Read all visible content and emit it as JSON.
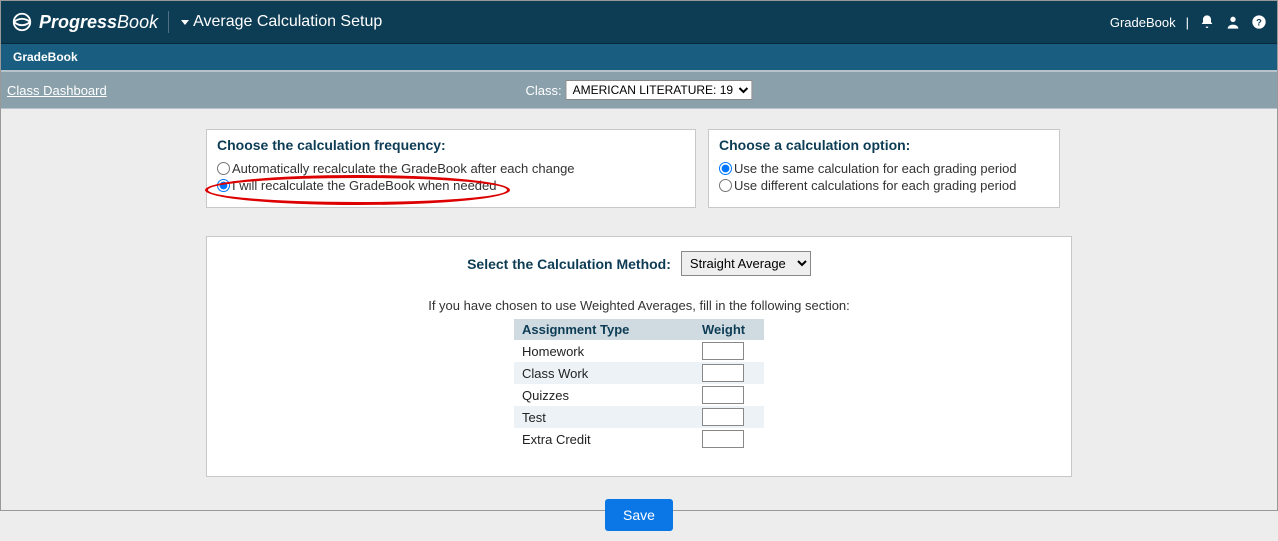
{
  "header": {
    "brand_name_bold": "Progress",
    "brand_name_rest": "Book",
    "page_title": "Average Calculation Setup",
    "right_link": "GradeBook"
  },
  "subheader": {
    "app_label": "GradeBook"
  },
  "graybar": {
    "dashboard_link": "Class Dashboard",
    "class_label": "Class:",
    "class_selected": "AMERICAN LITERATURE: 19"
  },
  "frequency_box": {
    "legend": "Choose the calculation frequency:",
    "option_auto": "Automatically recalculate the GradeBook after each change",
    "option_manual": "I will recalculate the GradeBook when needed"
  },
  "calc_option_box": {
    "legend": "Choose a calculation option:",
    "option_same": "Use the same calculation for each grading period",
    "option_diff": "Use different calculations for each grading period"
  },
  "method_box": {
    "label": "Select the Calculation Method:",
    "selected": "Straight Average",
    "hint": "If you have chosen to use Weighted Averages, fill in the following section:",
    "col_type": "Assignment Type",
    "col_weight": "Weight",
    "rows": [
      {
        "type": "Homework",
        "weight": ""
      },
      {
        "type": "Class Work",
        "weight": ""
      },
      {
        "type": "Quizzes",
        "weight": ""
      },
      {
        "type": "Test",
        "weight": ""
      },
      {
        "type": "Extra Credit",
        "weight": ""
      }
    ]
  },
  "save_label": "Save"
}
